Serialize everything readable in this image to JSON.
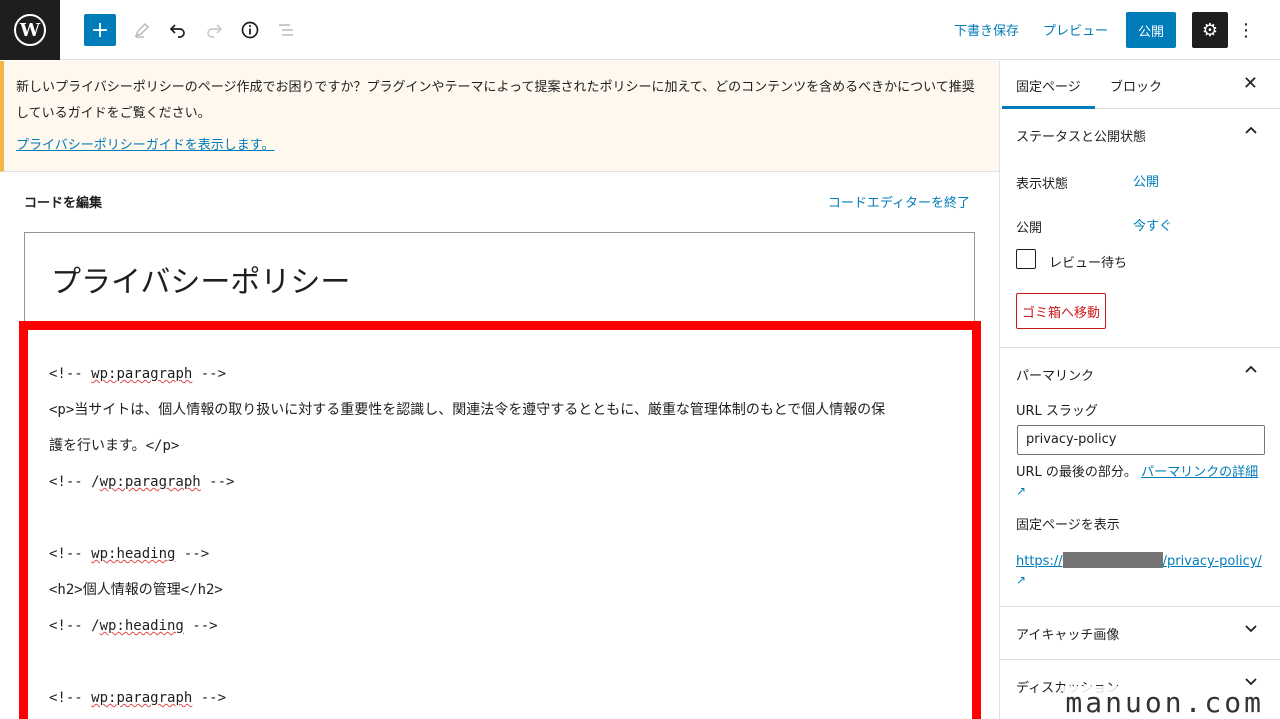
{
  "toolbar": {
    "save_draft": "下書き保存",
    "preview": "プレビュー",
    "publish": "公開"
  },
  "notice": {
    "text": "新しいプライバシーポリシーのページ作成でお困りですか？プラグインやテーマによって提案されたポリシーに加えて、どのコンテンツを含めるべきかについて推奨しているガイドをご覧ください。",
    "link": "プライバシーポリシーガイドを表示します。"
  },
  "editor": {
    "heading": "コードを編集",
    "exit": "コードエディターを終了",
    "title": "プライバシーポリシー",
    "code": {
      "l1_a": "<!-- ",
      "l1_b": "wp:paragraph",
      "l1_c": " -->",
      "l2": "<p>当サイトは、個人情報の取り扱いに対する重要性を認識し、関連法令を遵守するとともに、厳重な管理体制のもとで個人情報の保",
      "l3": "護を行います。</p>",
      "l4_a": "<!-- /",
      "l4_b": "wp:paragraph",
      "l4_c": " -->",
      "l5_a": "<!-- ",
      "l5_b": "wp:heading",
      "l5_c": " -->",
      "l6": "<h2>個人情報の管理</h2>",
      "l7_a": "<!-- /",
      "l7_b": "wp:heading",
      "l7_c": " -->",
      "l8_a": "<!-- ",
      "l8_b": "wp:paragraph",
      "l8_c": " -->"
    }
  },
  "sidebar": {
    "tab_page": "固定ページ",
    "tab_block": "ブロック",
    "status_panel": "ステータスと公開状態",
    "visibility_label": "表示状態",
    "visibility_value": "公開",
    "publish_label": "公開",
    "publish_value": "今すぐ",
    "pending_review": "レビュー待ち",
    "trash": "ゴミ箱へ移動",
    "permalink_panel": "パーマリンク",
    "url_slug_label": "URL スラッグ",
    "url_slug_value": "privacy-policy",
    "url_last_part": "URL の最後の部分。",
    "permalink_details": "パーマリンクの詳細",
    "view_page": "固定ページを表示",
    "url_prefix": "https://",
    "url_suffix": "/privacy-policy/",
    "featured_image": "アイキャッチ画像",
    "discussion": "ディスカッション"
  },
  "watermark": "manuon.com"
}
